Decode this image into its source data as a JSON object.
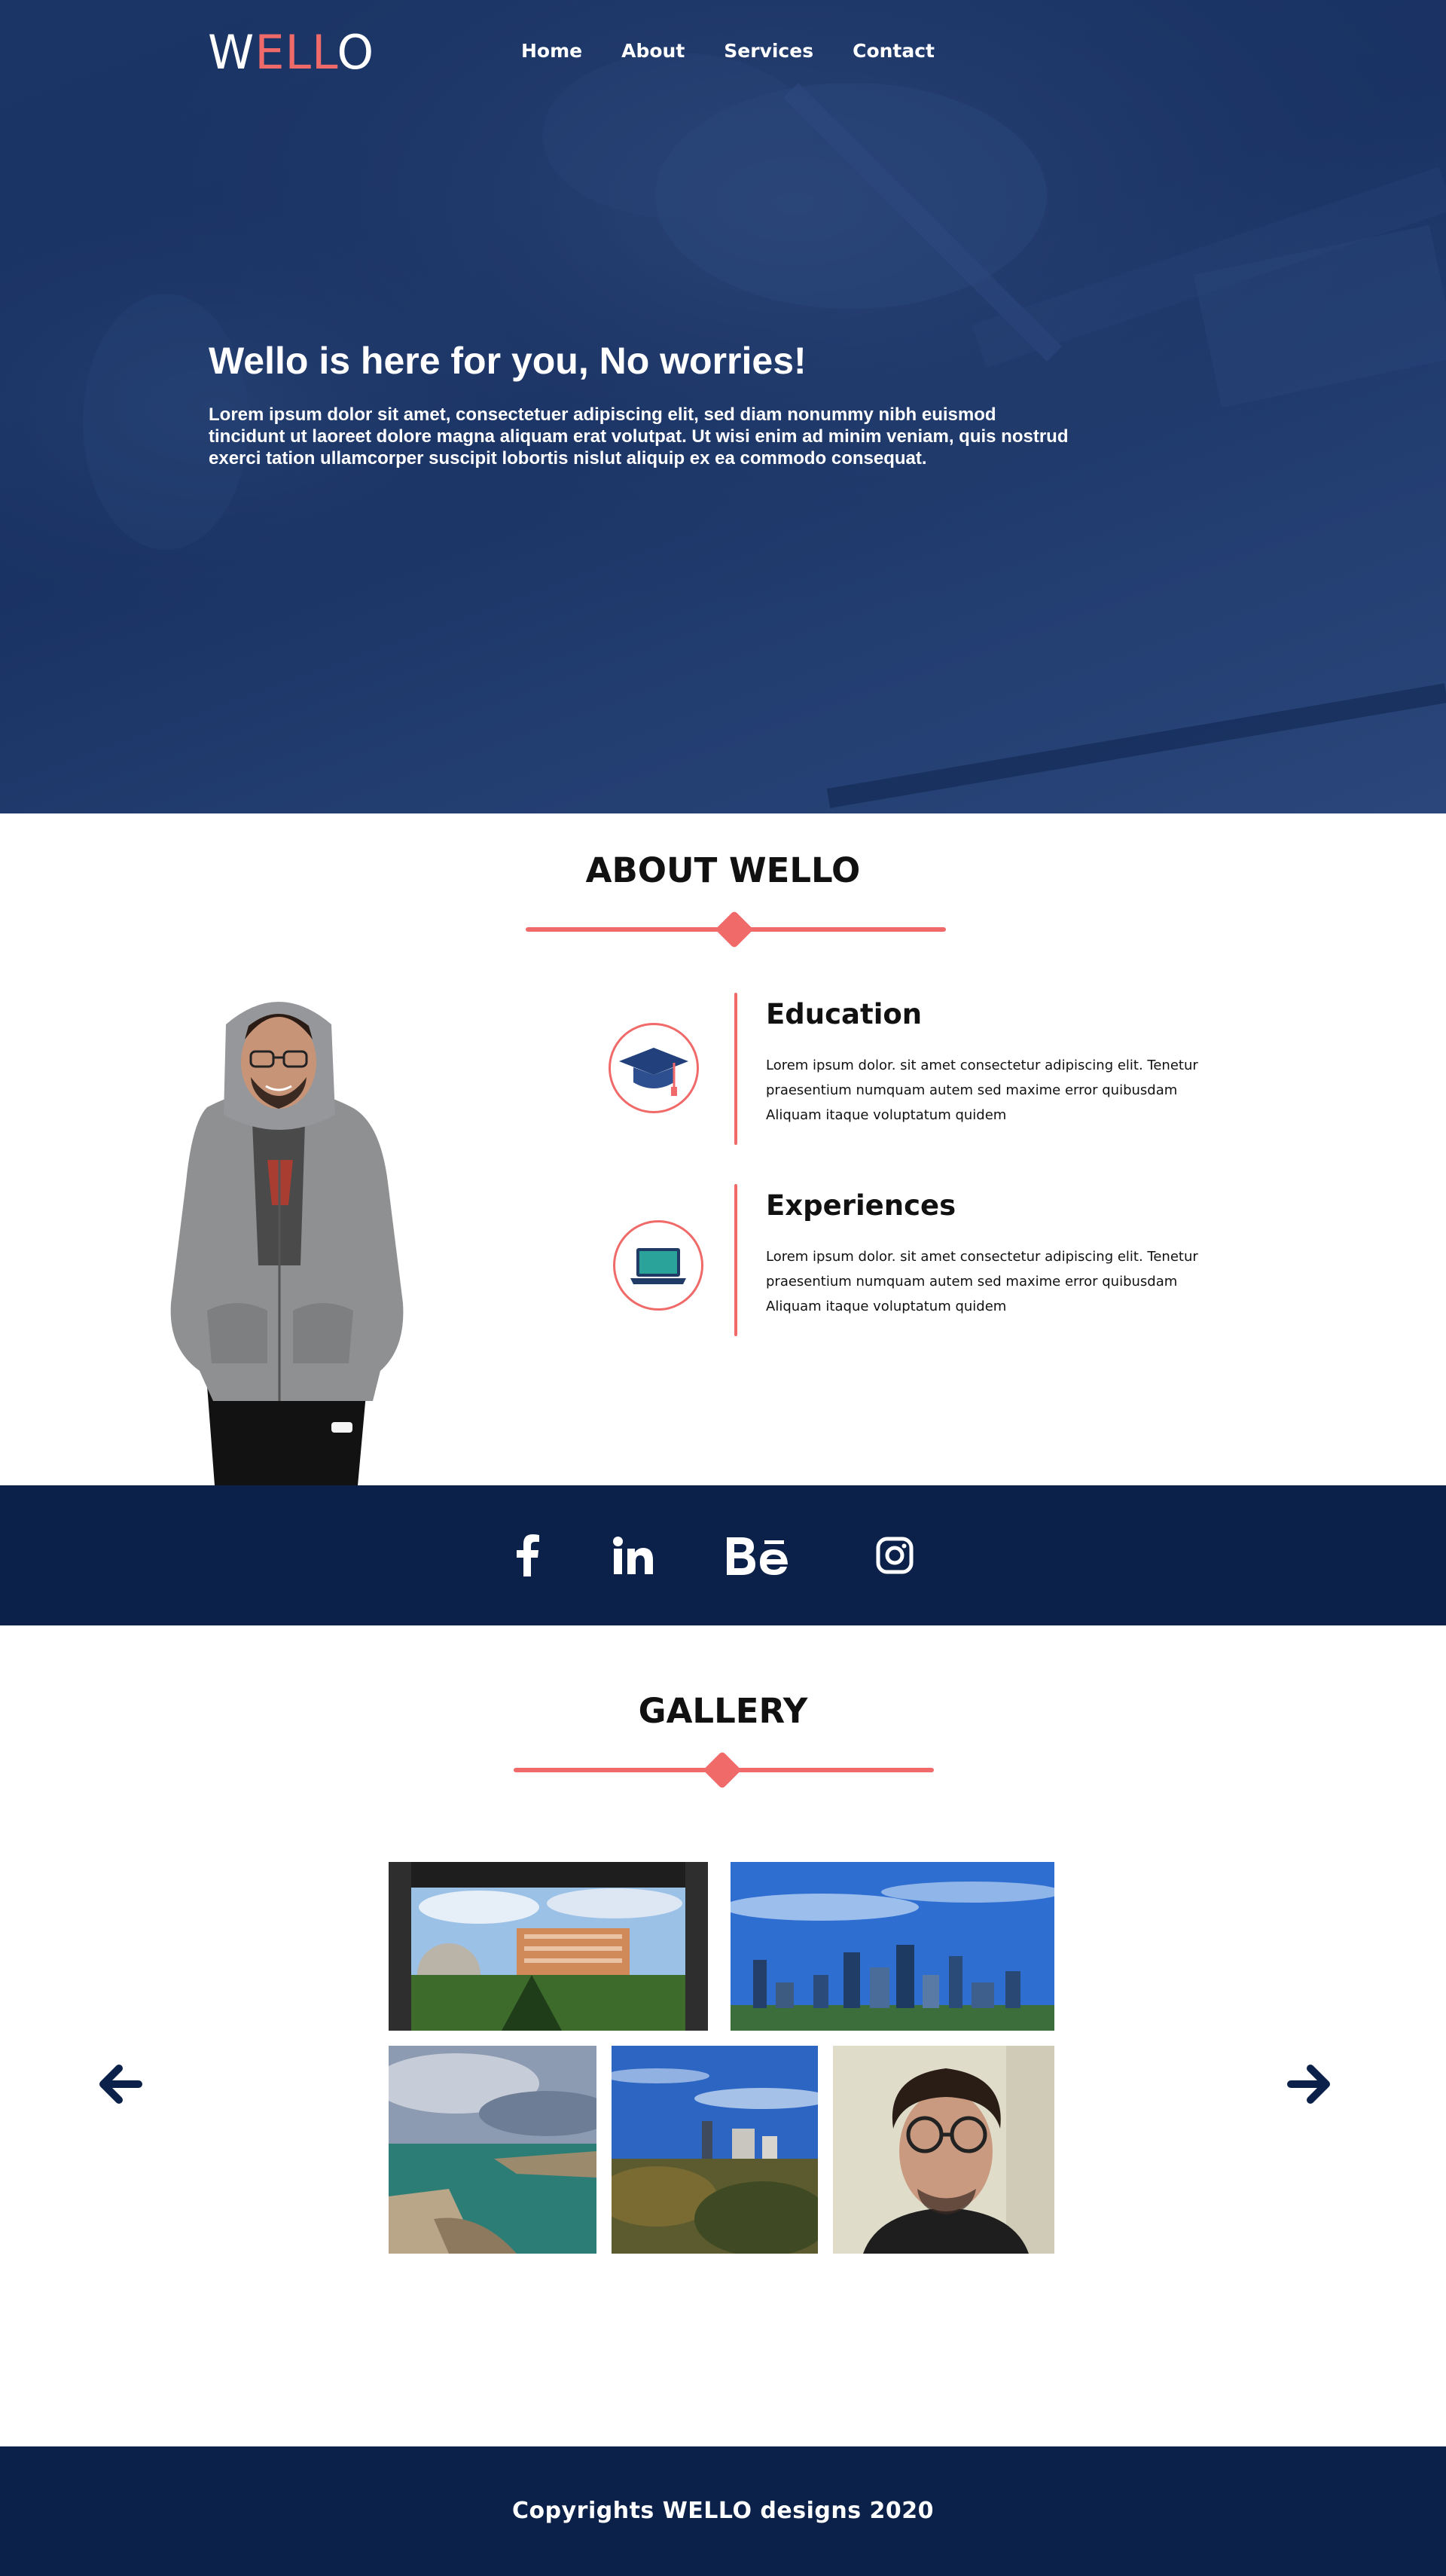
{
  "brand": {
    "logo_first": "W",
    "logo_mid": "ELL",
    "logo_last": "O",
    "accent_color": "#f06a6a",
    "primary_color": "#0b2149"
  },
  "nav": {
    "items": [
      {
        "label": "Home"
      },
      {
        "label": "About"
      },
      {
        "label": "Services"
      },
      {
        "label": "Contact"
      }
    ]
  },
  "hero": {
    "title": "Wello is here for you, No worries!",
    "text": "Lorem ipsum dolor sit amet, consectetuer adipiscing elit, sed diam nonummy nibh euismod tincidunt ut laoreet dolore magna aliquam erat volutpat. Ut wisi enim ad minim veniam, quis nostrud exerci tation ullamcorper suscipit lobortis nislut aliquip ex ea commodo consequat."
  },
  "about": {
    "title": "ABOUT WELLO",
    "items": [
      {
        "icon": "graduation-cap-icon",
        "heading": "Education",
        "text": "Lorem ipsum dolor. sit amet consectetur adipiscing elit. Tenetur praesentium numquam autem sed maxime error quibusdam Aliquam itaque voluptatum quidem"
      },
      {
        "icon": "laptop-icon",
        "heading": "Experiences",
        "text": "Lorem ipsum dolor. sit amet consectetur adipiscing elit. Tenetur praesentium numquam autem sed maxime error quibusdam Aliquam itaque voluptatum quidem"
      }
    ]
  },
  "social": {
    "icons": [
      {
        "name": "facebook-icon",
        "glyph": "f"
      },
      {
        "name": "linkedin-icon",
        "glyph": "in"
      },
      {
        "name": "behance-icon",
        "glyph": "Bē"
      },
      {
        "name": "instagram-icon",
        "glyph": ""
      }
    ]
  },
  "gallery": {
    "title": "GALLERY",
    "images": [
      "campus-photo",
      "city-skyline-photo",
      "coast-photo",
      "city-park-photo",
      "portrait-photo"
    ],
    "prev_icon": "arrow-left-icon",
    "next_icon": "arrow-right-icon"
  },
  "footer": {
    "text": "Copyrights WELLO designs 2020"
  }
}
